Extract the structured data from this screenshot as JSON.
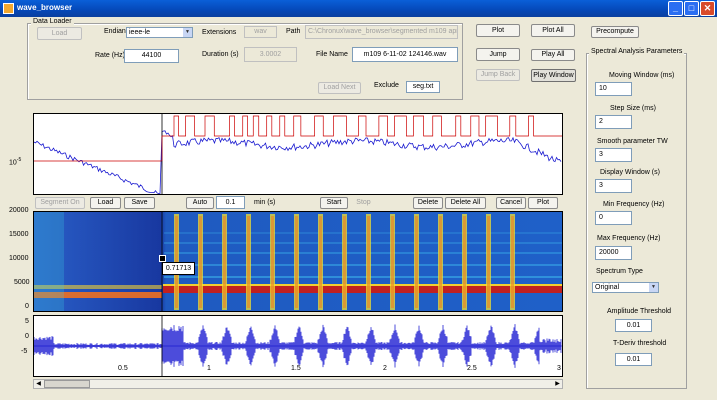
{
  "window": {
    "title": "wave_browser"
  },
  "data_loader": {
    "title": "Data Loader",
    "load_label": "Load",
    "endian_label": "Endian",
    "endian_value": "ieee-le",
    "extensions_label": "Extensions",
    "extensions_value": "wav",
    "path_label": "Path",
    "path_value": "C:\\Chronux\\wave_browser\\segmented m109 aprX",
    "rate_label": "Rate (Hz)",
    "rate_value": "44100",
    "duration_label": "Duration (s)",
    "duration_value": "3.0002",
    "filename_label": "File Name",
    "filename_value": "m109 6-11-02 124146.wav",
    "load_next_label": "Load Next",
    "exclude_label": "Exclude",
    "exclude_value": "seg.txt"
  },
  "top_buttons": {
    "plot": "Plot",
    "plot_all": "Plot All",
    "precompute": "Precompute",
    "jump": "Jump",
    "play_all": "Play All",
    "jump_back": "Jump Back",
    "play_window": "Play Window"
  },
  "spectral": {
    "title": "Spectral Analysis Parameters",
    "moving_window_label": "Moving Window (ms)",
    "moving_window_value": "10",
    "step_size_label": "Step Size (ms)",
    "step_size_value": "2",
    "smooth_label": "Smooth parameter TW",
    "smooth_value": "3",
    "display_window_label": "Display Window (s)",
    "display_window_value": "3",
    "min_freq_label": "Min Frequency (Hz)",
    "min_freq_value": "0",
    "max_freq_label": "Max Frequency (Hz)",
    "max_freq_value": "20000",
    "spectrum_type_label": "Spectrum Type",
    "spectrum_type_value": "Original",
    "amp_threshold_label": "Amplitude Threshold",
    "amp_threshold_value": "0.01",
    "tderiv_label": "T-Deriv threshold",
    "tderiv_value": "0.01"
  },
  "mid_toolbar": {
    "segment_on": "Segment On",
    "load": "Load",
    "save": "Save",
    "auto": "Auto",
    "min_value": "0.1",
    "min_unit": "min (s)",
    "start": "Start",
    "stop": "Stop",
    "delete": "Delete",
    "delete_all": "Delete All",
    "cancel": "Cancel",
    "plot": "Plot"
  },
  "spectrum_plot": {
    "ylabel_tick": "10",
    "ylabel_exp": "-5"
  },
  "spectrogram": {
    "yticks": [
      "20000",
      "15000",
      "10000",
      "5000",
      "0"
    ],
    "marker_value": "0.71713"
  },
  "waveform": {
    "yticks": [
      "5",
      "0",
      "-5"
    ],
    "xticks": [
      "0.5",
      "1",
      "1.5",
      "2",
      "2.5",
      "3"
    ]
  },
  "colors": {
    "titlebar": "#0548b8",
    "panel_bg": "#ece9d8",
    "trace": "#0000cc",
    "segment": "#cc0000"
  }
}
